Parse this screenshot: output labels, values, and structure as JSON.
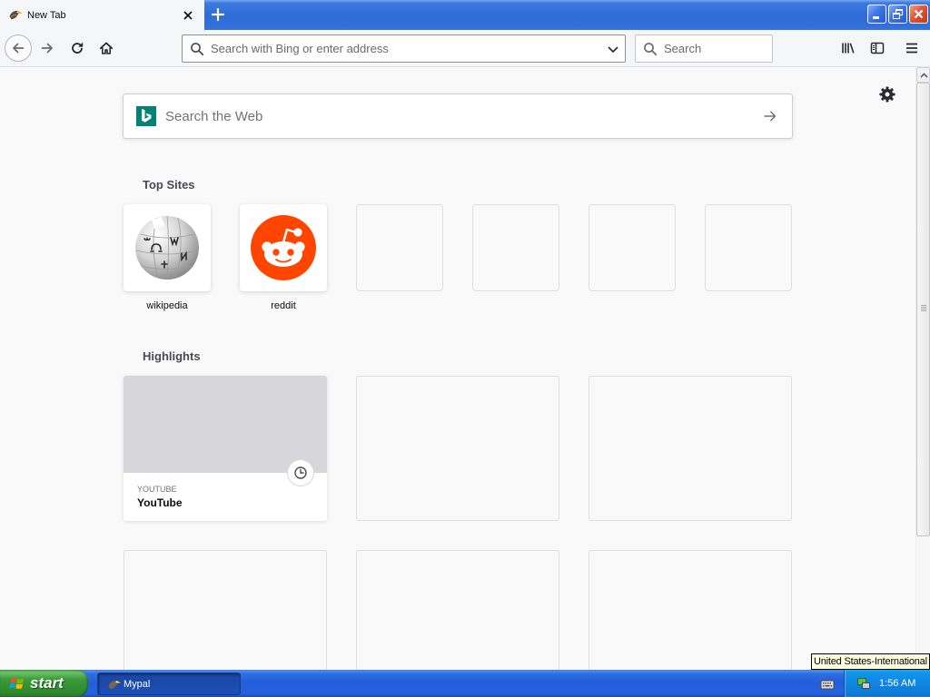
{
  "browser": {
    "tab": {
      "title": "New Tab",
      "favicon": "mypal-bird-icon",
      "close_icon": "close-icon"
    },
    "new_tab_icon": "plus-icon",
    "window_controls": [
      "minimize-icon",
      "restore-icon",
      "close-icon"
    ]
  },
  "toolbar": {
    "nav_icons": [
      "back-arrow-icon",
      "forward-arrow-icon",
      "reload-icon",
      "home-icon"
    ],
    "url_placeholder": "Search with Bing or enter address",
    "search_placeholder": "Search",
    "right_icons": [
      "library-icon",
      "sidebar-icon",
      "menu-icon"
    ]
  },
  "newtab": {
    "settings_icon": "gear-icon",
    "search": {
      "placeholder": "Search the Web",
      "engine_icon": "bing-logo-icon",
      "submit_icon": "arrow-right-icon"
    },
    "top_sites_heading": "Top Sites",
    "top_sites": [
      {
        "label": "wikipedia",
        "icon": "wikipedia-globe-icon"
      },
      {
        "label": "reddit",
        "icon": "reddit-alien-icon"
      }
    ],
    "highlights_heading": "Highlights",
    "highlights": [
      {
        "source": "YOUTUBE",
        "title": "YouTube",
        "badge_icon": "clock-icon"
      }
    ]
  },
  "taskbar": {
    "start_label": "start",
    "tasks": [
      {
        "label": "Mypal",
        "icon": "mypal-bird-icon"
      }
    ],
    "tray_icons": [
      "keyboard-icon",
      "network-icon"
    ],
    "clock": "1:56 AM",
    "tooltip": "United States-International"
  },
  "colors": {
    "reddit": "#ff4500",
    "bing": "#008373",
    "taskbar": "#245edb",
    "start": "#3c9b3b",
    "page_background": "#f9f9fa"
  }
}
